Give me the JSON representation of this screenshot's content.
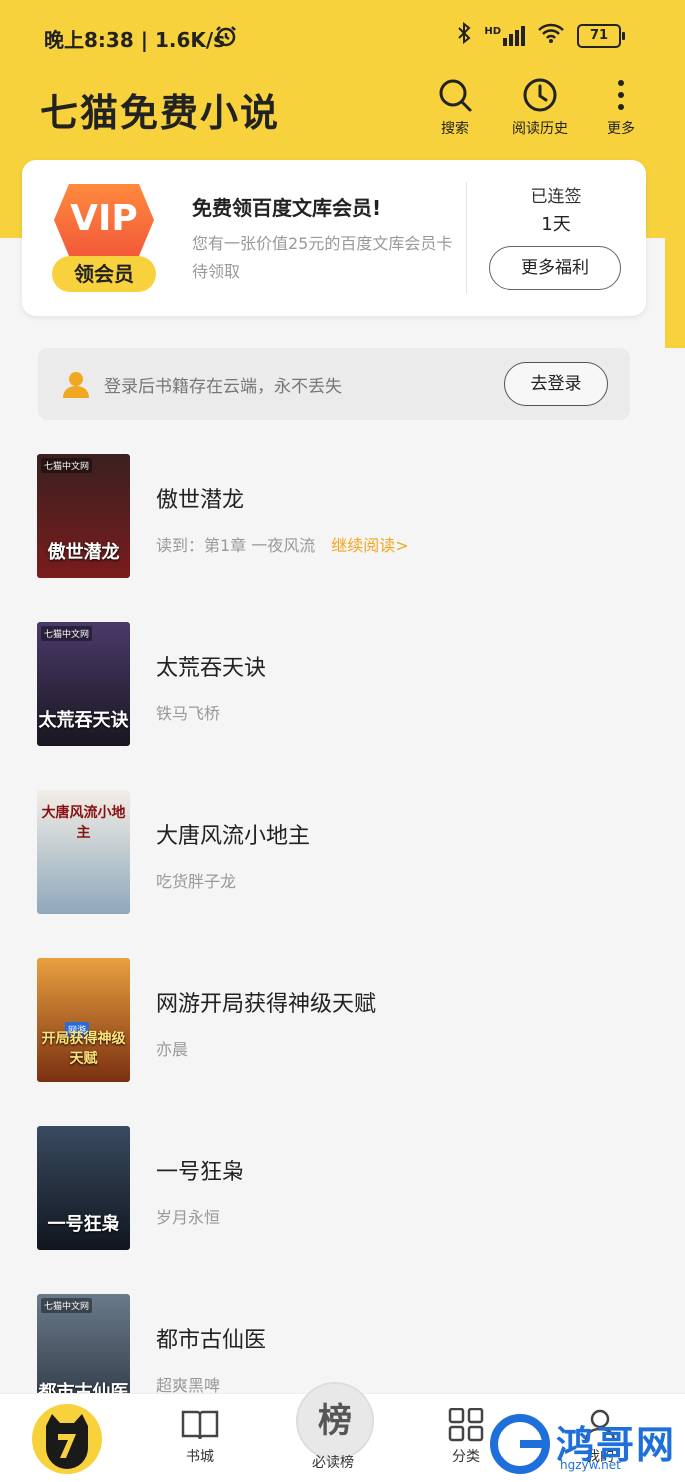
{
  "status_bar": {
    "time_speed": "晚上8:38 | 1.6K/s",
    "battery": "71",
    "network": "HD"
  },
  "header": {
    "app_title": "七猫免费小说",
    "actions": [
      {
        "label": "搜索",
        "icon": "search-icon"
      },
      {
        "label": "阅读历史",
        "icon": "clock-icon"
      },
      {
        "label": "更多",
        "icon": "more-vertical-icon"
      }
    ]
  },
  "vip_card": {
    "badge_text": "VIP",
    "badge_pill": "领会员",
    "title": "免费领百度文库会员!",
    "desc": "您有一张价值25元的百度文库会员卡待领取",
    "streak_label": "已连签",
    "streak_value": "1天",
    "more_button": "更多福利"
  },
  "login_bar": {
    "text": "登录后书籍存在云端，永不丢失",
    "button": "去登录"
  },
  "books": [
    {
      "title": "傲世潜龙",
      "sub": "读到：第1章  一夜风流",
      "continue": "继续阅读>",
      "cover_text": "傲世潜龙",
      "cover_tag": "七猫中文网",
      "cover_color": "#7a1c1c"
    },
    {
      "title": "太荒吞天诀",
      "sub": "铁马飞桥",
      "continue": "",
      "cover_text": "太荒吞天诀",
      "cover_tag": "七猫中文网",
      "cover_color": "#2a2438"
    },
    {
      "title": "大唐风流小地主",
      "sub": "吃货胖子龙",
      "continue": "",
      "cover_text": "大唐风流小地主",
      "cover_tag": "",
      "cover_color": "#9bb3c4"
    },
    {
      "title": "网游开局获得神级天赋",
      "sub": "亦晨",
      "continue": "",
      "cover_text": "开局获得神级天赋",
      "cover_tag": "网游",
      "cover_color": "#c2762a"
    },
    {
      "title": "一号狂枭",
      "sub": "岁月永恒",
      "continue": "",
      "cover_text": "一号狂枭",
      "cover_tag": "",
      "cover_color": "#1f2a3a"
    },
    {
      "title": "都市古仙医",
      "sub": "超爽黑啤",
      "continue": "",
      "cover_text": "都市古仙医",
      "cover_tag": "七猫中文网",
      "cover_color": "#4a5a6a"
    }
  ],
  "bottom_nav": {
    "items": [
      {
        "label": "书城",
        "icon": "book-open-icon"
      },
      {
        "label": "必读榜",
        "icon": "rank-icon",
        "badge": "榜"
      },
      {
        "label": "分类",
        "icon": "grid-icon"
      },
      {
        "label": "我的",
        "icon": "user-icon"
      }
    ]
  },
  "watermark": {
    "text": "鸿哥网",
    "sub": "hgzyw.net"
  },
  "colors": {
    "brand_yellow": "#f7d23c",
    "accent_orange": "#f0a820",
    "vip_orange": "#f2593a"
  }
}
